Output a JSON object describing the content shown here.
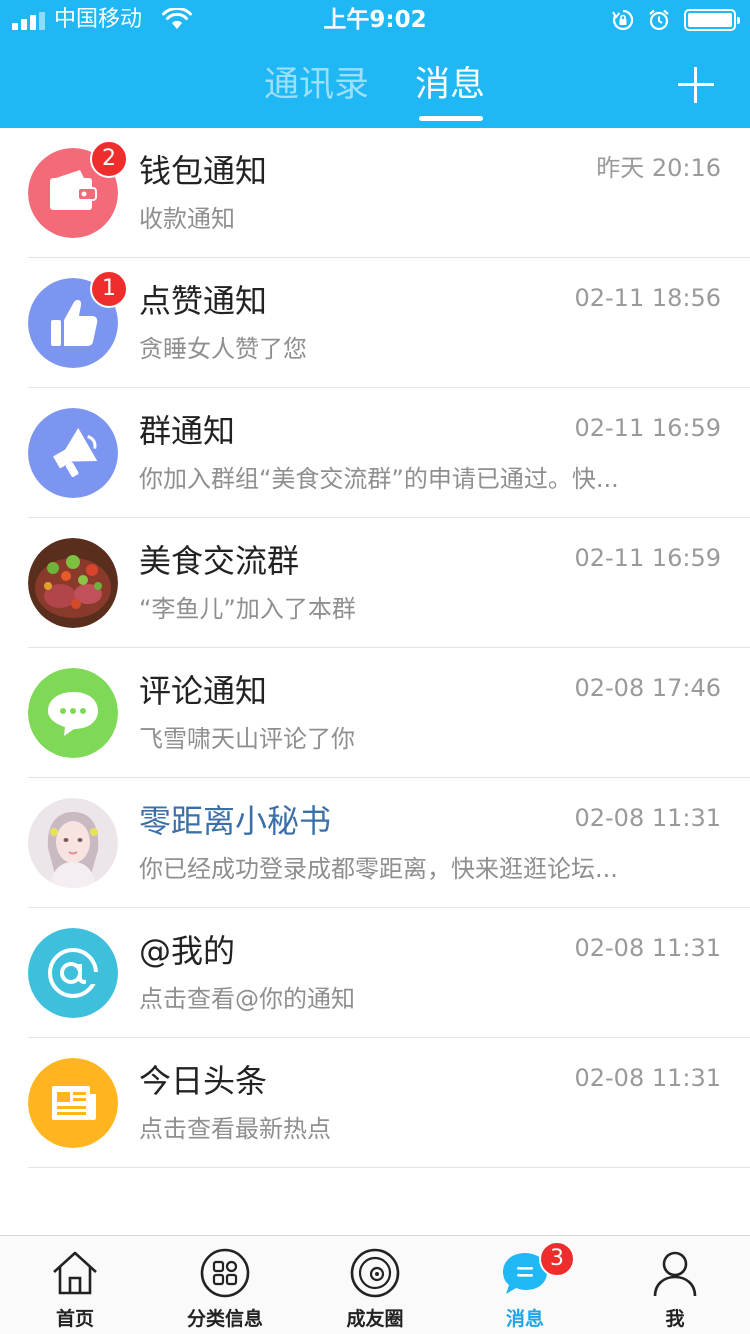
{
  "status_bar": {
    "carrier": "中国移动",
    "time": "上午9:02"
  },
  "header": {
    "tabs": [
      {
        "label": "通讯录",
        "active": false
      },
      {
        "label": "消息",
        "active": true
      }
    ],
    "add_icon": "plus-icon"
  },
  "colors": {
    "accent": "#1fb8f5",
    "badge": "#f02d2d",
    "highlight_title": "#3b6fa8"
  },
  "messages": [
    {
      "title": "钱包通知",
      "preview": "收款通知",
      "time": "昨天 20:16",
      "badge": "2",
      "icon": "wallet-icon",
      "avatar_color": "#f56a78"
    },
    {
      "title": "点赞通知",
      "preview": "贪睡女人赞了您",
      "time": "02-11 18:56",
      "badge": "1",
      "icon": "thumbs-up-icon",
      "avatar_color": "#7b95f0"
    },
    {
      "title": "群通知",
      "preview": "你加入群组“美食交流群”的申请已通过。快...",
      "time": "02-11 16:59",
      "icon": "megaphone-icon",
      "avatar_color": "#7b95f0"
    },
    {
      "title": "美食交流群",
      "preview": "“李鱼儿”加入了本群",
      "time": "02-11 16:59",
      "icon": "food-photo-avatar"
    },
    {
      "title": "评论通知",
      "preview": "飞雪啸天山评论了你",
      "time": "02-08 17:46",
      "icon": "comment-bubble-icon",
      "avatar_color": "#7ed957"
    },
    {
      "title": "零距离小秘书",
      "preview": "你已经成功登录成都零距离，快来逛逛论坛...",
      "time": "02-08 11:31",
      "icon": "person-photo-avatar"
    },
    {
      "title": "@我的",
      "preview": "点击查看@你的通知",
      "time": "02-08 11:31",
      "icon": "at-sign-icon",
      "avatar_color": "#3ec0dc"
    },
    {
      "title": "今日头条",
      "preview": "点击查看最新热点",
      "time": "02-08 11:31",
      "icon": "newspaper-icon",
      "avatar_color": "#ffb51f"
    }
  ],
  "bottom_nav": [
    {
      "label": "首页",
      "icon": "home-icon"
    },
    {
      "label": "分类信息",
      "icon": "grid-icon"
    },
    {
      "label": "成友圈",
      "icon": "orbit-icon"
    },
    {
      "label": "消息",
      "icon": "chat-bubble-icon",
      "active": true,
      "badge": "3"
    },
    {
      "label": "我",
      "icon": "user-icon"
    }
  ]
}
